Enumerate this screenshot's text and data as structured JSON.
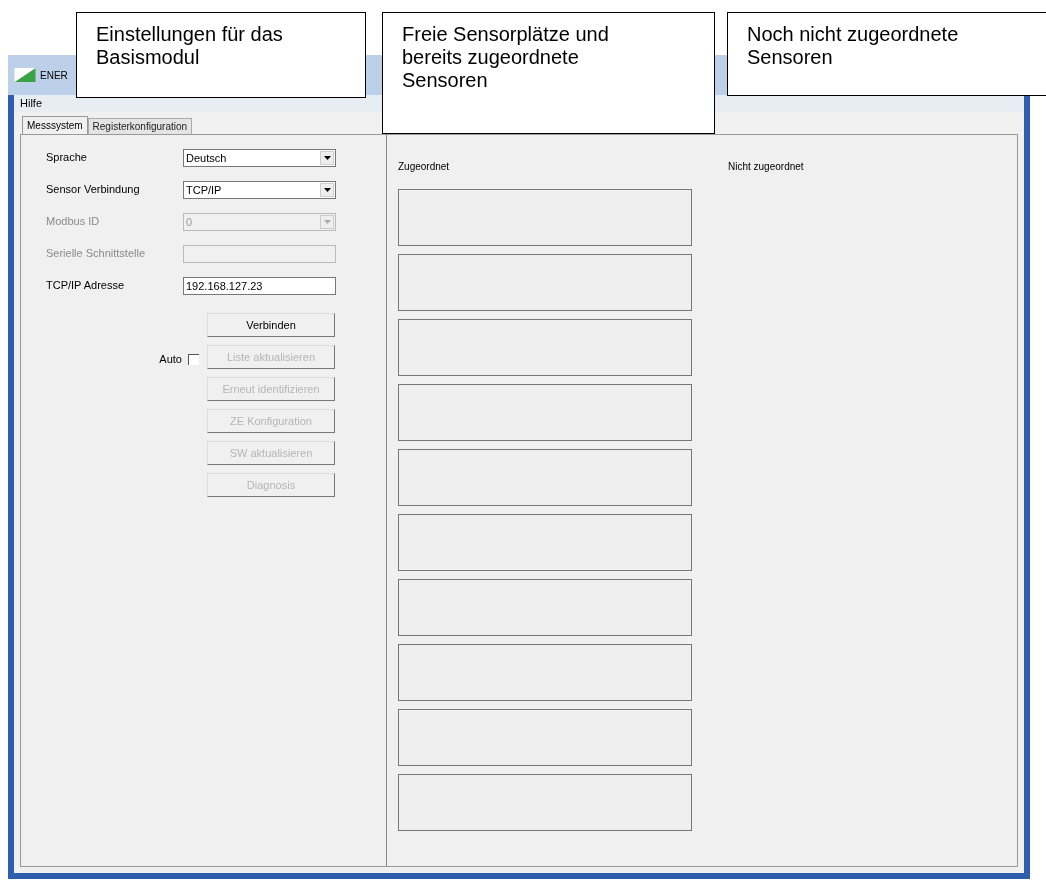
{
  "window": {
    "title": "ENER"
  },
  "menu": [
    "Hilfe"
  ],
  "tabs": [
    {
      "label": "Messsystem",
      "selected": true
    },
    {
      "label": "Registerkonfiguration",
      "selected": false
    }
  ],
  "fields": [
    {
      "label": "Sprache",
      "kind": "combo",
      "value": "Deutsch",
      "disabled": false
    },
    {
      "label": "Sensor Verbindung",
      "kind": "combo",
      "value": "TCP/IP",
      "disabled": false
    },
    {
      "label": "Modbus ID",
      "kind": "combo",
      "value": "0",
      "disabled": true
    },
    {
      "label": "Serielle Schnittstelle",
      "kind": "text",
      "disabled": true
    },
    {
      "label": "TCP/IP Adresse",
      "kind": "text",
      "value": "192.168.127.23",
      "disabled": false
    }
  ],
  "buttons": [
    {
      "label": "Verbinden",
      "disabled": false
    },
    {
      "label": "Liste aktualisieren",
      "disabled": true
    },
    {
      "label": "Erneut identifizieren",
      "disabled": true
    },
    {
      "label": "ZE Konfiguration",
      "disabled": true
    },
    {
      "label": "SW aktualisieren",
      "disabled": true
    },
    {
      "label": "Diagnosis",
      "disabled": true
    }
  ],
  "auto": {
    "label": "Auto",
    "checked": false
  },
  "assigned": {
    "heading": "Zugeordnet",
    "slots": [
      {
        "kind": "empty"
      },
      {
        "kind": "empty"
      },
      {
        "kind": "empty"
      },
      {
        "kind": "empty"
      },
      {
        "kind": "empty"
      },
      {
        "kind": "empty"
      },
      {
        "kind": "empty"
      },
      {
        "kind": "empty"
      },
      {
        "kind": "empty"
      },
      {
        "kind": "empty"
      }
    ]
  },
  "unassigned": {
    "heading": "Nicht zugeordnet"
  },
  "callouts": [
    {
      "text": "Einstellungen für das Basismodul"
    },
    {
      "text": "Freie Sensorplätze und bereits zugeordnete Sensoren"
    },
    {
      "text": "Noch nicht zugeordnete Sensoren"
    }
  ]
}
